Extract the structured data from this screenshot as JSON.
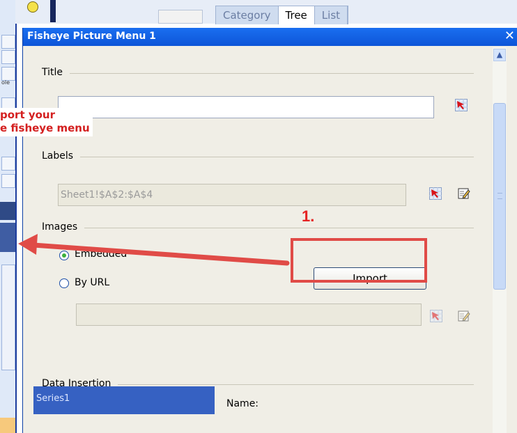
{
  "background": {
    "tabs": [
      {
        "label": "Category",
        "active": false
      },
      {
        "label": "Tree",
        "active": true
      },
      {
        "label": "List",
        "active": false
      }
    ]
  },
  "dialog": {
    "title": "Fisheye Picture Menu 1",
    "close_icon": "close-icon",
    "sections": {
      "title": {
        "label": "Title",
        "value": "",
        "icon": "cell-select-icon"
      },
      "labels": {
        "label": "Labels",
        "value": "Sheet1!$A$2:$A$4",
        "icons": [
          "cell-select-icon",
          "edit-icon"
        ]
      },
      "images": {
        "label": "Images",
        "options": [
          {
            "label": "Embedded",
            "selected": true
          },
          {
            "label": "By URL",
            "selected": false
          }
        ],
        "url_value": "",
        "import_label": "Import",
        "icons": [
          "cell-select-icon",
          "edit-icon"
        ]
      },
      "data_insertion": {
        "label": "Data Insertion",
        "series": [
          "Series1"
        ],
        "name_label": "Name:"
      }
    }
  },
  "annotations": {
    "callout_text": "port your\ne fisheye menu",
    "step_label": "1.",
    "colors": {
      "annotation_red": "#e04b47",
      "title_blue": "#0d55d8"
    }
  }
}
